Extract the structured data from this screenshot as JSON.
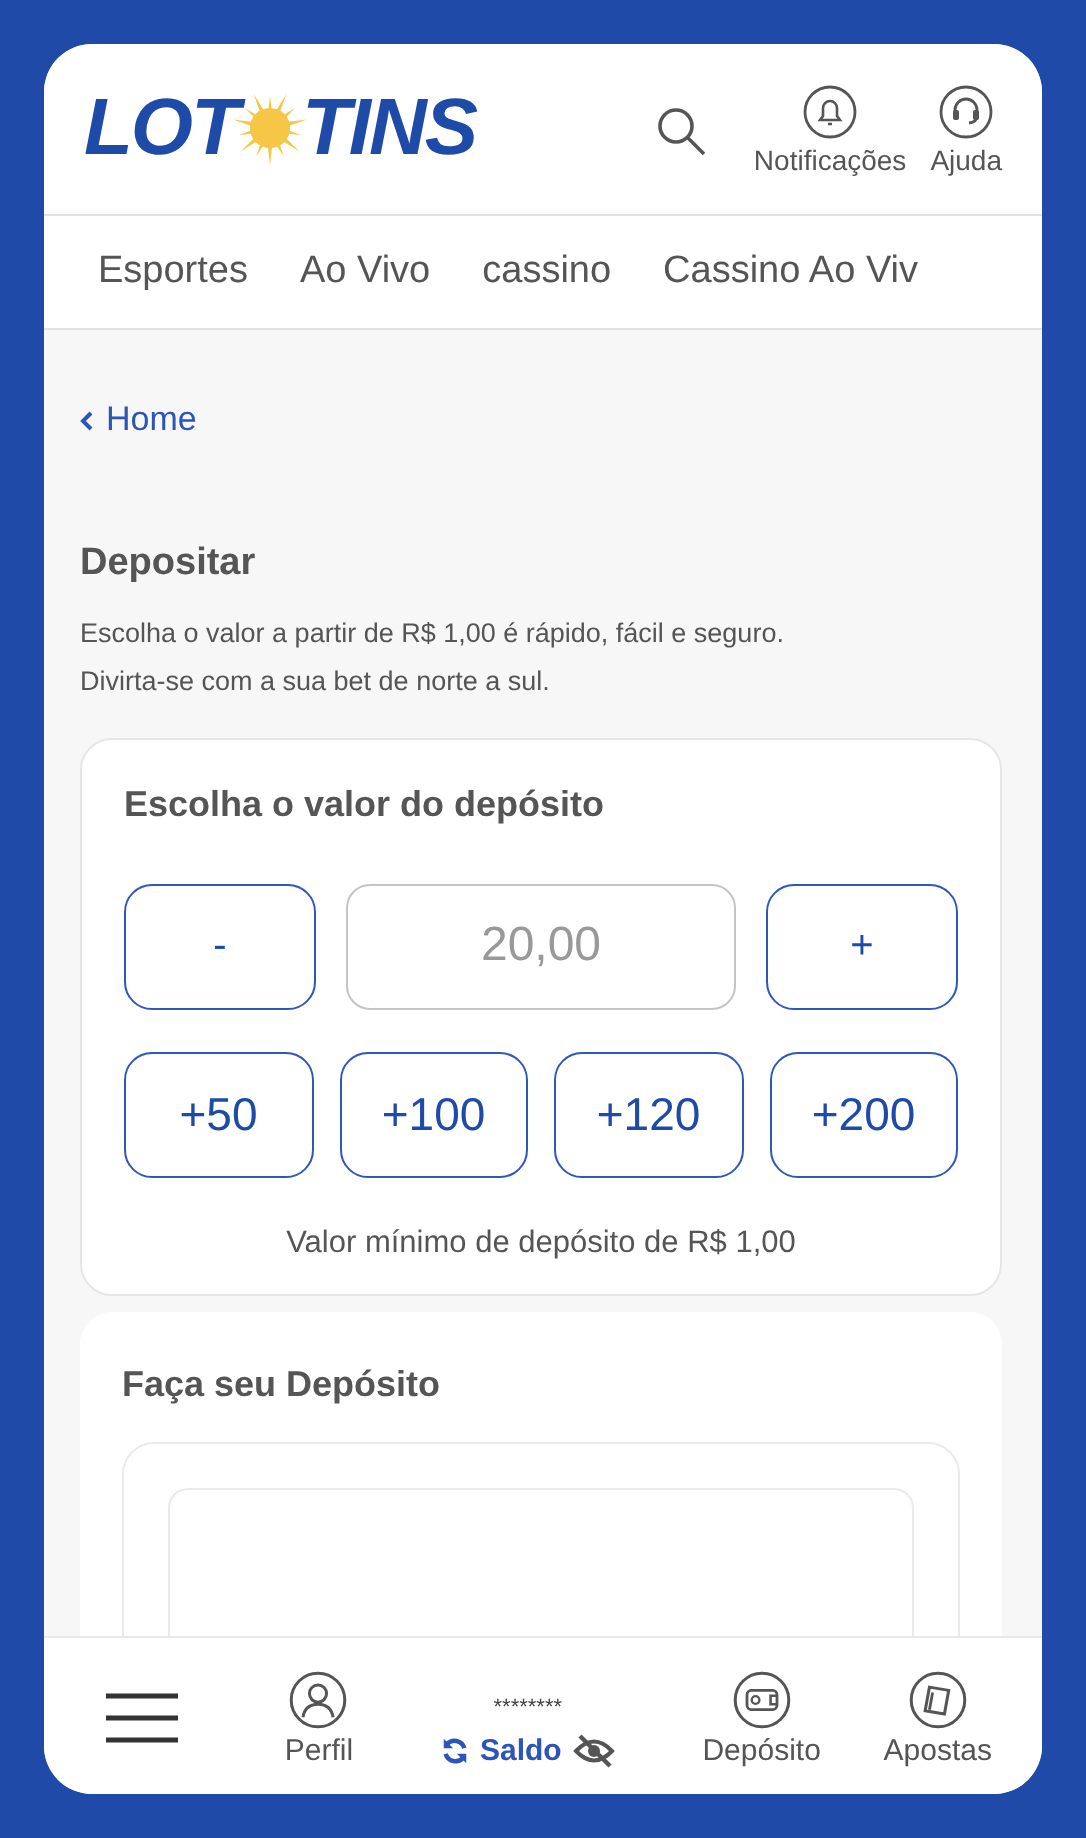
{
  "header": {
    "logo": {
      "left": "LOT",
      "right": "TINS"
    },
    "actions": [
      {
        "kind": "search"
      },
      {
        "kind": "bell",
        "label": "Notificações"
      },
      {
        "kind": "headset",
        "label": "Ajuda"
      }
    ]
  },
  "nav_tabs": [
    {
      "label": "Esportes"
    },
    {
      "label": "Ao Vivo"
    },
    {
      "label": "cassino"
    },
    {
      "label": "Cassino Ao Viv"
    }
  ],
  "breadcrumb": {
    "label": "Home"
  },
  "page": {
    "title": "Depositar",
    "description": [
      "Escolha o valor a partir de R$ 1,00 é rápido, fácil e seguro.",
      "Divirta-se com a sua bet de norte a sul."
    ]
  },
  "amount_card": {
    "title": "Escolha o valor do depósito",
    "decrement": "-",
    "value": "20,00",
    "increment": "+",
    "presets": [
      "+50",
      "+100",
      "+120",
      "+200"
    ],
    "minimum_note": "Valor mínimo de depósito de R$ 1,00"
  },
  "deposit_card": {
    "title": "Faça seu Depósito"
  },
  "bottom_nav": {
    "items": [
      {
        "kind": "menu"
      },
      {
        "kind": "profile",
        "label": "Perfil"
      },
      {
        "kind": "balance",
        "masked": "********",
        "label": "Saldo"
      },
      {
        "kind": "wallet",
        "label": "Depósito"
      },
      {
        "kind": "bets",
        "label": "Apostas"
      }
    ]
  }
}
